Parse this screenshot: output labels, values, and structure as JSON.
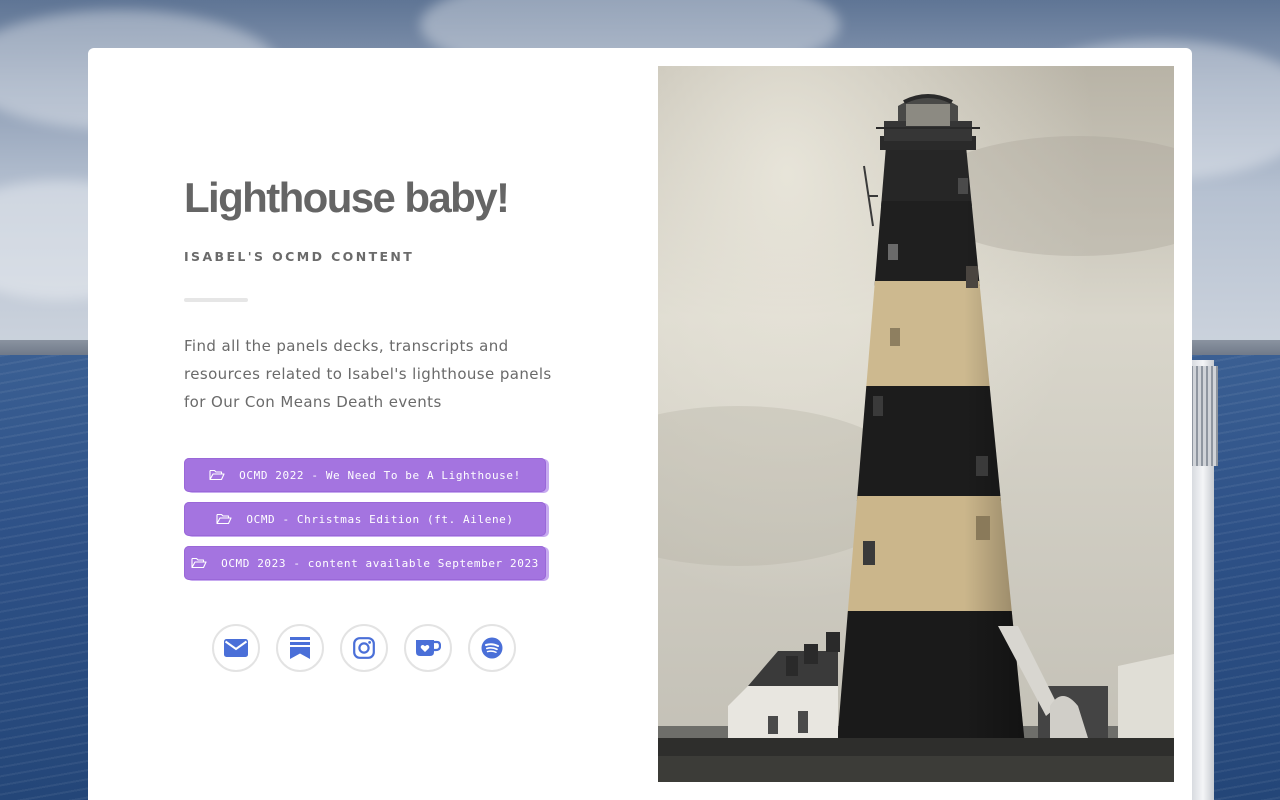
{
  "title": "Lighthouse baby!",
  "subtitle": "ISABEL'S OCMD CONTENT",
  "description": "Find all the panels decks, transcripts and resources related to Isabel's lighthouse panels for Our Con Means Death events",
  "buttons": [
    {
      "label": "OCMD 2022 - We Need To be A Lighthouse!",
      "icon": "folder-open-icon"
    },
    {
      "label": "OCMD - Christmas Edition (ft. Ailene)",
      "icon": "folder-open-icon"
    },
    {
      "label": "OCMD 2023 - content available September 2023",
      "icon": "folder-open-icon"
    }
  ],
  "socials": [
    {
      "icon": "email-icon"
    },
    {
      "icon": "bookmark-icon"
    },
    {
      "icon": "instagram-icon"
    },
    {
      "icon": "kofi-icon"
    },
    {
      "icon": "spotify-icon"
    }
  ],
  "colors": {
    "accent": "#a474e0",
    "icon_blue": "#4a6fd8",
    "title_gray": "#656565"
  }
}
